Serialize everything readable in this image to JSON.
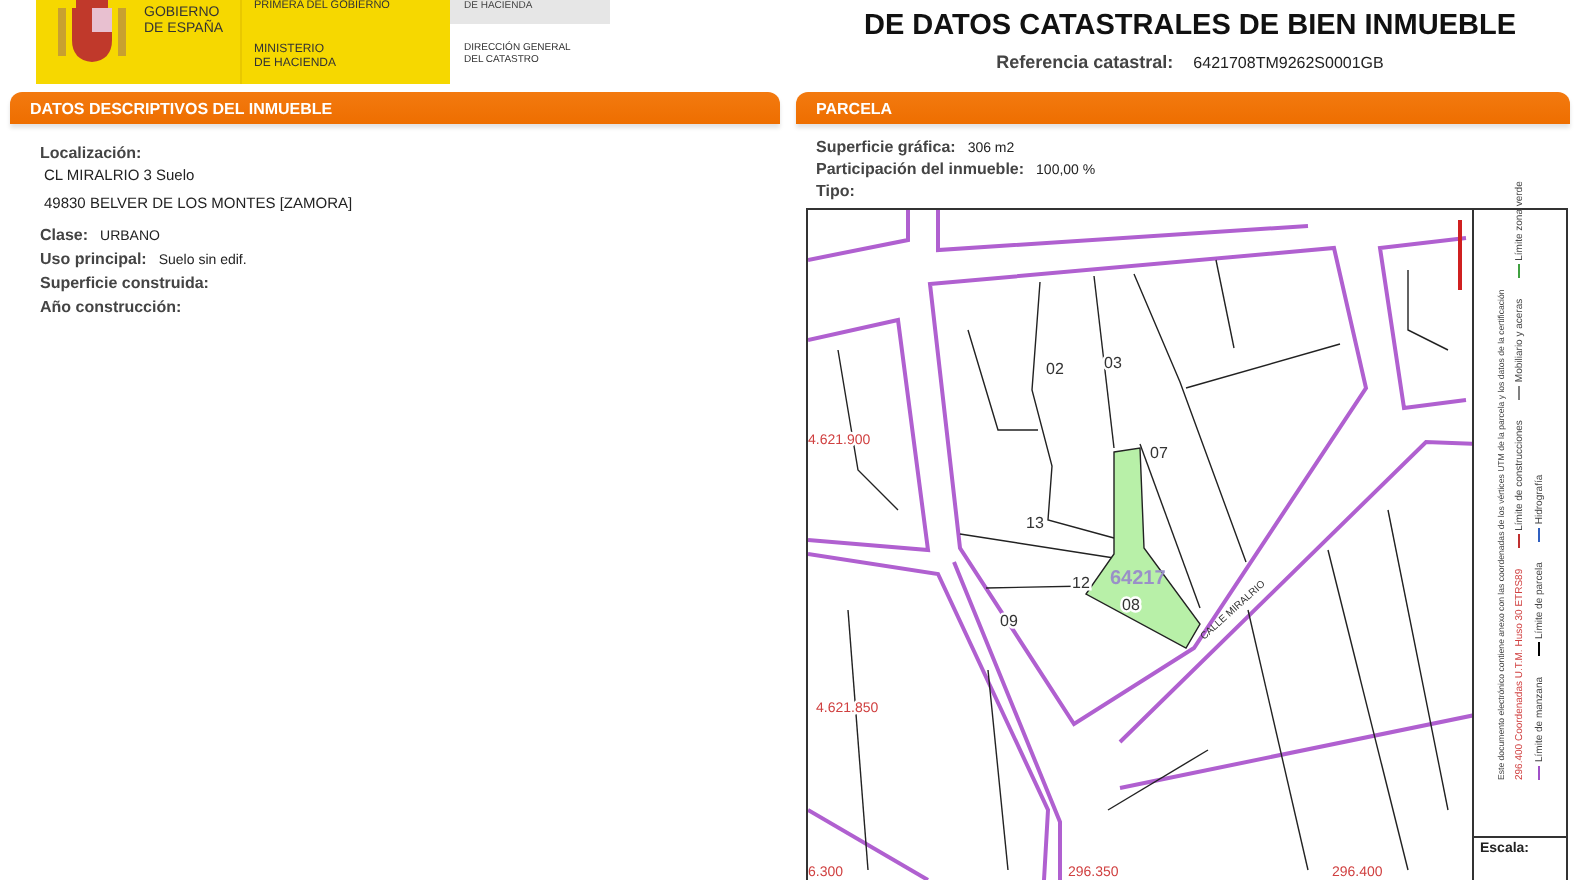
{
  "header": {
    "government": "GOBIERNO\nDE ESPAÑA",
    "vicepresidency": "PRIMERA DEL GOBIERNO",
    "ministry": "MINISTERIO\nDE HACIENDA",
    "gray_box": "DE HACIENDA",
    "directorate": "DIRECCIÓN GENERAL\nDEL CATASTRO",
    "title": "DE DATOS CATASTRALES DE BIEN INMUEBLE",
    "reference_label": "Referencia catastral:",
    "reference_value": "6421708TM9262S0001GB"
  },
  "property_section": {
    "title": "DATOS DESCRIPTIVOS DEL INMUEBLE",
    "location_label": "Localización:",
    "location_lines": [
      "CL MIRALRIO 3 Suelo",
      "49830 BELVER DE LOS MONTES [ZAMORA]"
    ],
    "fields": [
      {
        "label": "Clase:",
        "value": "URBANO"
      },
      {
        "label": "Uso principal:",
        "value": "Suelo sin edif."
      },
      {
        "label": "Superficie construida:"
      },
      {
        "label": "Año construcción:"
      }
    ]
  },
  "parcel_section": {
    "title": "PARCELA",
    "fields": [
      {
        "label": "Superficie gráfica:",
        "value": "306 m2"
      },
      {
        "label": "Participación del inmueble:",
        "value": "100,00 %"
      },
      {
        "label": "Tipo:"
      }
    ],
    "map": {
      "labels": [
        {
          "text": "02",
          "kind": "subparcel"
        },
        {
          "text": "03",
          "kind": "subparcel"
        },
        {
          "text": "07",
          "kind": "subparcel"
        },
        {
          "text": "13",
          "kind": "subparcel"
        },
        {
          "text": "12",
          "kind": "subparcel"
        },
        {
          "text": "09",
          "kind": "subparcel"
        },
        {
          "text": "64217",
          "kind": "block"
        },
        {
          "text": "08",
          "kind": "subparcel"
        },
        {
          "text": "4.621.900",
          "kind": "coordinate"
        },
        {
          "text": "4.621.850",
          "kind": "coordinate"
        },
        {
          "text": "6.300",
          "kind": "coordinate"
        },
        {
          "text": "296.350",
          "kind": "coordinate"
        },
        {
          "text": "296.400",
          "kind": "coordinate"
        },
        {
          "text": "CALLE MIRALRIO",
          "kind": "street"
        }
      ],
      "legend": {
        "items": [
          {
            "text": "Límite de manzana",
            "color": "#a050c8"
          },
          {
            "text": "Límite de parcela",
            "color": "#000000"
          },
          {
            "text": "Hidrografía",
            "color": "#3060c0"
          },
          {
            "text": "Límite de construcciones",
            "color": "#c03030"
          },
          {
            "text": "Mobiliario y aceras",
            "color": "#808080"
          },
          {
            "text": "Límite zona verde",
            "color": "#40a040"
          }
        ],
        "coordinates_note": "296.400 Coordenadas U.T.M. Huso 30 ETRS89",
        "note": "Este documento electrónico contiene anexo con las coordenadas de los vértices UTM de la parcela y los datos de la certificación",
        "scale_label": "Escala:"
      }
    }
  }
}
